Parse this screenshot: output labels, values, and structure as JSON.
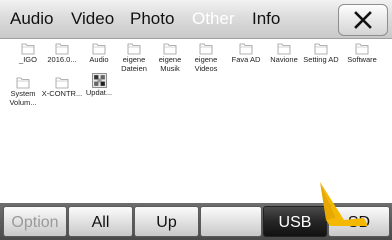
{
  "header": {
    "tabs": [
      {
        "label": "Audio",
        "active": false
      },
      {
        "label": "Video",
        "active": false
      },
      {
        "label": "Photo",
        "active": false
      },
      {
        "label": "Other",
        "active": true
      },
      {
        "label": "Info",
        "active": false
      }
    ],
    "close_icon": "close-icon"
  },
  "files": [
    {
      "name": "_IGO",
      "icon": "folder-icon"
    },
    {
      "name": "2016.0...",
      "icon": "folder-icon"
    },
    {
      "name": "Audio",
      "icon": "folder-icon"
    },
    {
      "name": "eigene Dateien",
      "icon": "folder-icon"
    },
    {
      "name": "eigene Musik",
      "icon": "folder-icon"
    },
    {
      "name": "eigene Videos",
      "icon": "folder-icon"
    },
    {
      "name": "Fava AD",
      "icon": "folder-icon"
    },
    {
      "name": "Navione",
      "icon": "folder-icon"
    },
    {
      "name": "Setting AD",
      "icon": "folder-icon"
    },
    {
      "name": "Software",
      "icon": "folder-icon"
    },
    {
      "name": "System Volum...",
      "icon": "folder-icon"
    },
    {
      "name": "X-CONTR...",
      "icon": "folder-icon"
    },
    {
      "name": "Updat...",
      "icon": "executable-icon"
    }
  ],
  "bottom_bar": {
    "buttons": [
      {
        "label": "Option",
        "state": "disabled"
      },
      {
        "label": "All",
        "state": "normal"
      },
      {
        "label": "Up",
        "state": "normal"
      },
      {
        "label": "",
        "state": "normal"
      },
      {
        "label": "USB",
        "state": "selected"
      },
      {
        "label": "SD",
        "state": "normal"
      }
    ]
  },
  "colors": {
    "header_bg": "#d4d4d4",
    "active_tab_text": "#ffffff",
    "bottom_bar_bg": "#5a5a5a",
    "selected_button_bg": "#1a1a1a",
    "cursor": "#f5b800"
  }
}
